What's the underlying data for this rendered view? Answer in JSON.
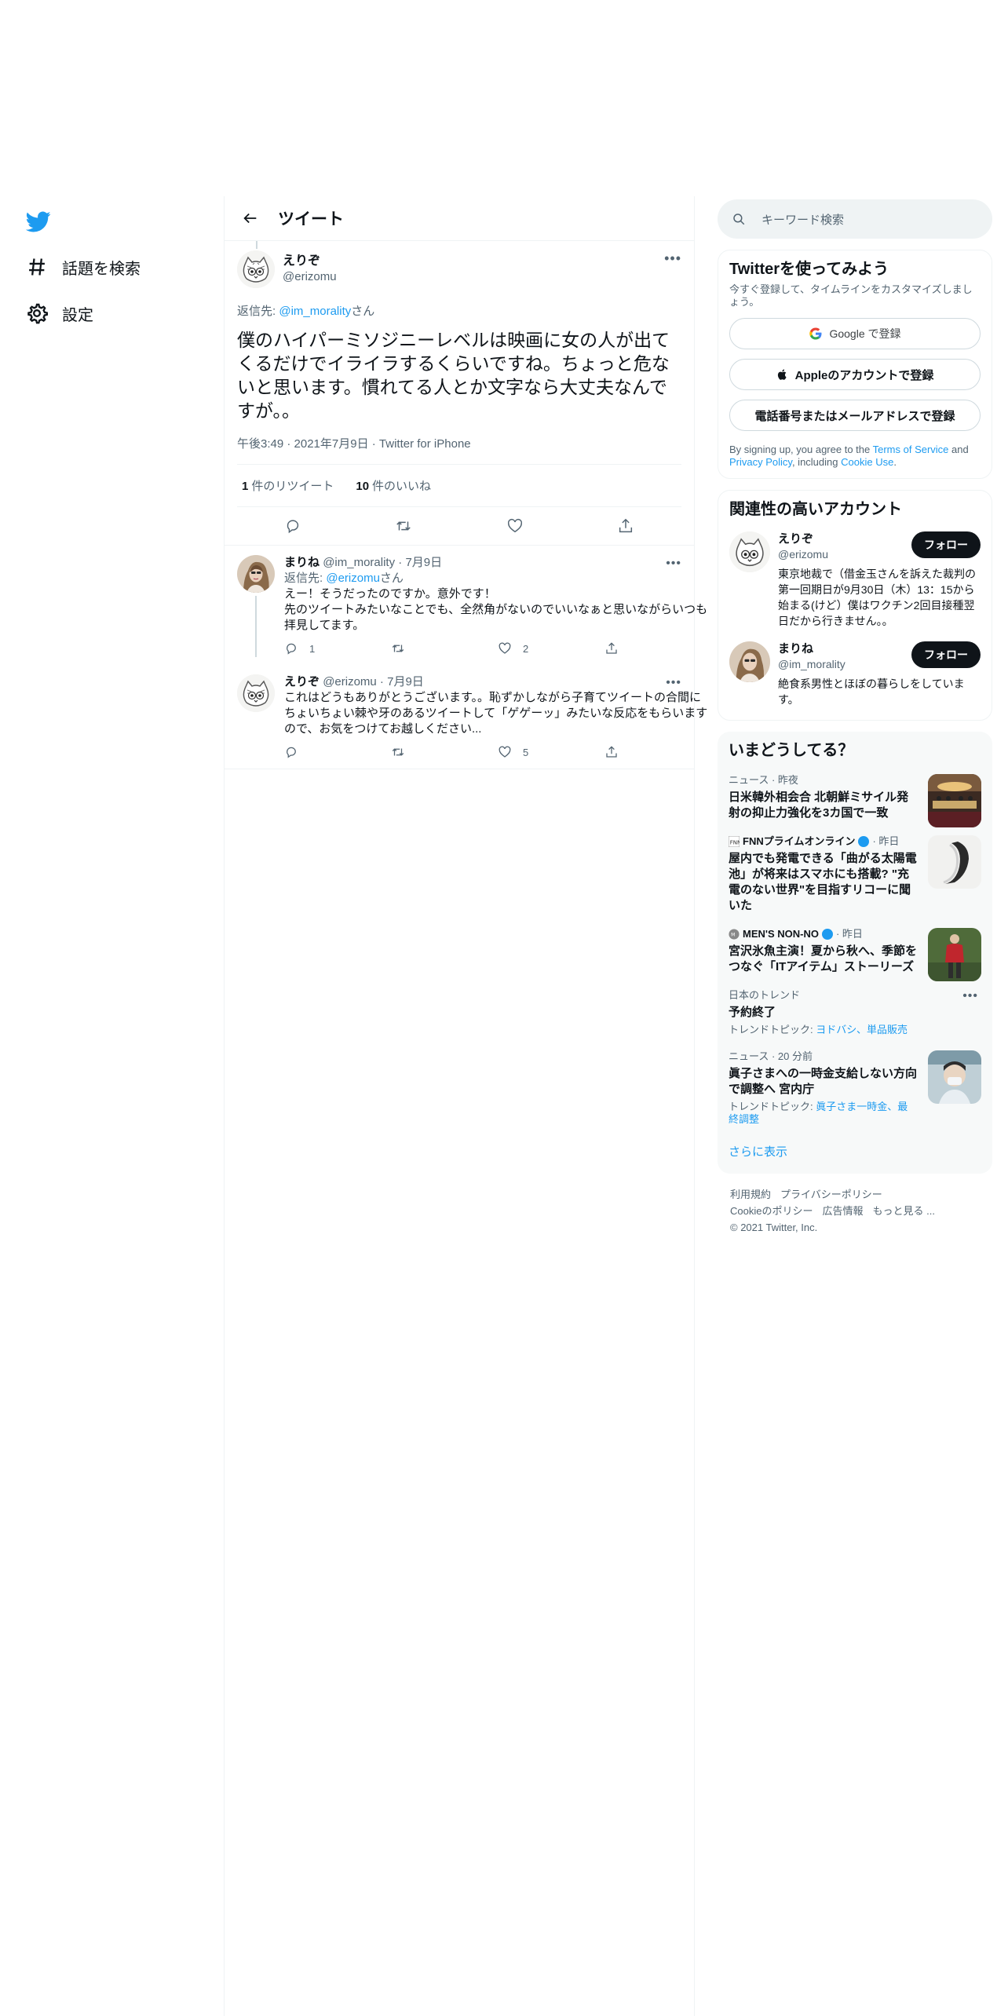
{
  "nav": {
    "explore_label": "話題を検索",
    "settings_label": "設定"
  },
  "header": {
    "title": "ツイート"
  },
  "focal_tweet": {
    "author_name": "えりぞ",
    "author_handle": "@erizomu",
    "reply_to_prefix": "返信先: ",
    "reply_to_mention": "@im_morality",
    "reply_to_suffix": "さん",
    "text": "僕のハイパーミソジニーレベルは映画に女の人が出てくるだけでイライラするくらいですね。ちょっと危ないと思います。慣れてる人とか文字なら大丈夫なんですが。。",
    "meta": "午後3:49 · 2021年7月9日 · Twitter for iPhone",
    "retweet_count": "1",
    "retweet_label": "件のリツイート",
    "like_count": "10",
    "like_label": "件のいいね"
  },
  "replies": [
    {
      "name": "まりね",
      "handle": "@im_morality",
      "date": "7月9日",
      "reply_to_prefix": "返信先: ",
      "reply_to_mention": "@erizomu",
      "reply_to_suffix": "さん",
      "line1": "えー！そうだったのですか。意外です！",
      "line2": "先のツイートみたいなことでも、全然角がないのでいいなぁと思いながらいつも拝見してます。",
      "reply_count": "1",
      "retweet_count": "",
      "like_count": "2"
    },
    {
      "name": "えりぞ",
      "handle": "@erizomu",
      "date": "7月9日",
      "text": "これはどうもありがとうございます。。恥ずかしながら子育てツイートの合間にちょいちょい棘や牙のあるツイートして「ゲゲーッ」みたいな反応をもらいますので、お気をつけてお越しください...",
      "reply_count": "",
      "retweet_count": "",
      "like_count": "5"
    }
  ],
  "search": {
    "placeholder": "キーワード検索"
  },
  "signup": {
    "title": "Twitterを使ってみよう",
    "subtitle": "今すぐ登録して、タイムラインをカスタマイズしましょう。",
    "google_label": "Google で登録",
    "apple_label": "Appleのアカウントで登録",
    "phone_label": "電話番号またはメールアドレスで登録",
    "terms_prefix": "By signing up, you agree to the ",
    "terms_link": "Terms of Service",
    "terms_and": " and ",
    "privacy_link": "Privacy Policy",
    "terms_including": ", including ",
    "cookie_link": "Cookie Use",
    "terms_end": "."
  },
  "related": {
    "title": "関連性の高いアカウント",
    "accounts": [
      {
        "name": "えりぞ",
        "handle": "@erizomu",
        "bio": "東京地裁で（借金玉さんを訴えた裁判の第一回期日が9月30日（木）13：15から始まる(けど）僕はワクチン2回目接種翌日だから行きません。。",
        "follow_label": "フォロー"
      },
      {
        "name": "まりね",
        "handle": "@im_morality",
        "bio": "絶食系男性とほぼの暮らしをしています。",
        "follow_label": "フォロー"
      }
    ]
  },
  "trends": {
    "title": "いまどうしてる？",
    "items": [
      {
        "meta": "ニュース · 昨夜",
        "title": "日米韓外相会合 北朝鮮ミサイル発射の抑止力強化を3カ国で一致"
      },
      {
        "source": "FNNプライムオンライン",
        "source_time": "· 昨日",
        "title": "屋内でも発電できる「曲がる太陽電池」が将来はスマホにも搭載? \"充電のない世界\"を目指すリコーに聞いた"
      },
      {
        "source": "MEN'S NON-NO",
        "source_time": "· 昨日",
        "title": "宮沢氷魚主演！夏から秋へ、季節をつなぐ「ITアイテム」ストーリーズ"
      },
      {
        "meta": "日本のトレンド",
        "title": "予約終了",
        "topic_prefix": "トレンドトピック: ",
        "topic_links": "ヨドバシ、単品販売"
      },
      {
        "meta": "ニュース · 20 分前",
        "title": "眞子さまへの一時金支給しない方向で調整へ 宮内庁",
        "topic_prefix": "トレンドトピック: ",
        "topic_links": "眞子さま一時金、最終調整"
      }
    ],
    "show_more": "さらに表示"
  },
  "footer": {
    "terms": "利用規約",
    "privacy": "プライバシーポリシー",
    "cookie": "Cookieのポリシー",
    "ads": "広告情報",
    "more": "もっと見る ...",
    "copyright": "© 2021 Twitter, Inc."
  },
  "colors": {
    "accent": "#1d9bf0",
    "text": "#0f1419",
    "muted": "#536471",
    "border": "#eff3f4"
  }
}
